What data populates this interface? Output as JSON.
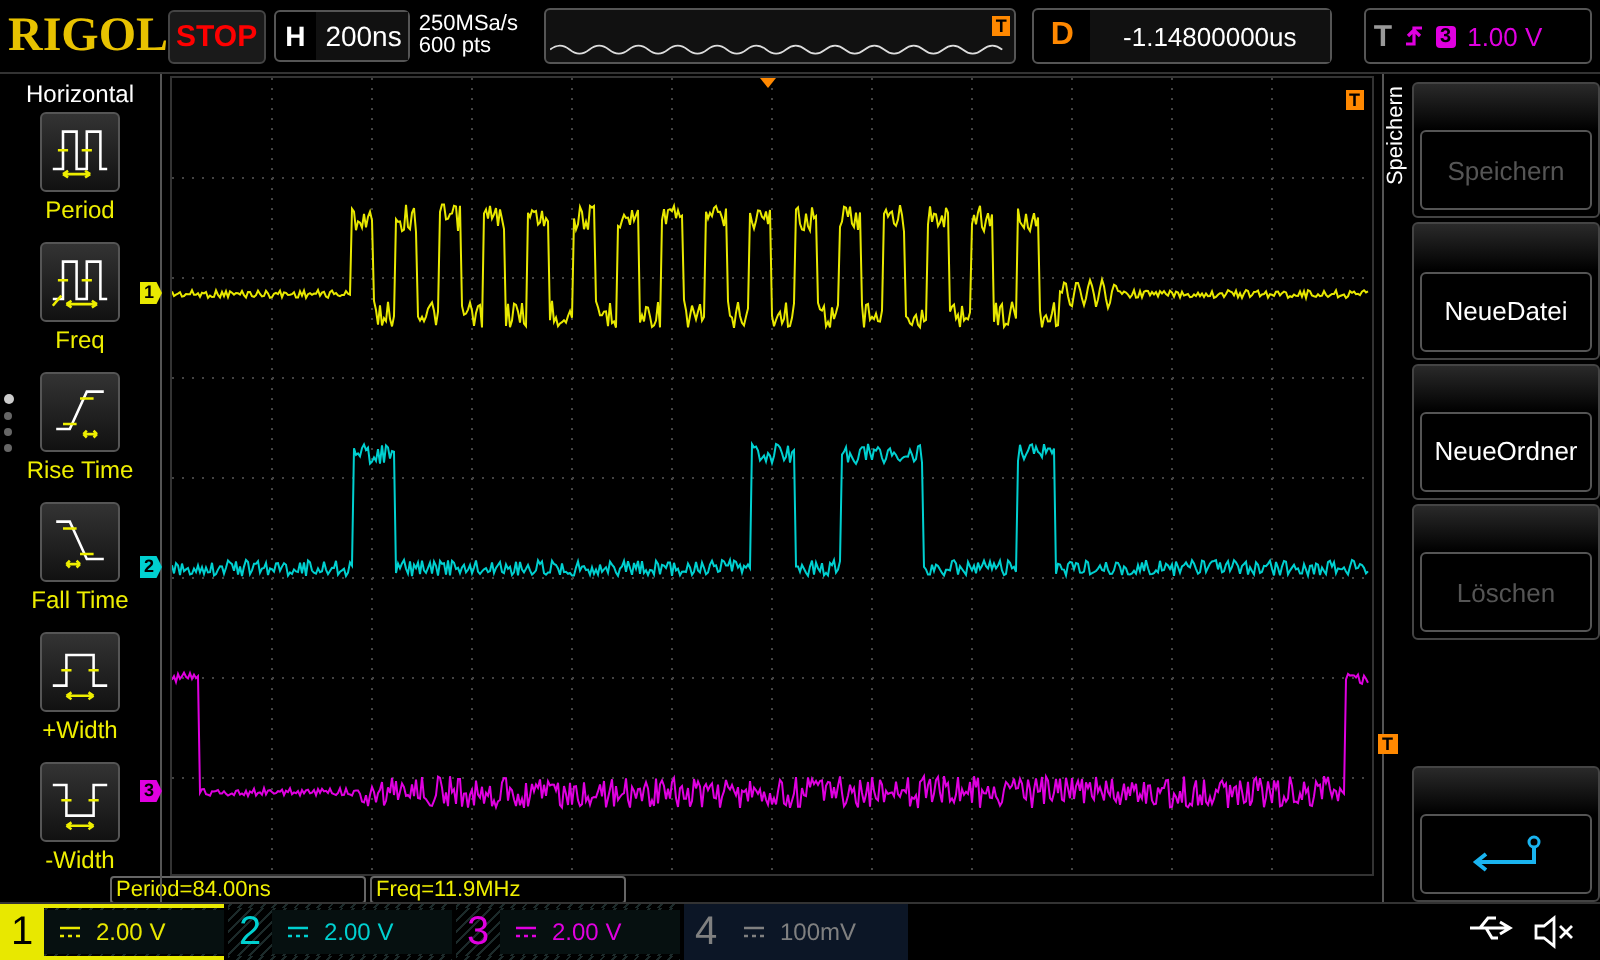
{
  "brand": "RIGOL",
  "run_state": {
    "label": "STOP"
  },
  "horizontal": {
    "key": "H",
    "timebase": "200ns"
  },
  "acquisition": {
    "sample_rate": "250MSa/s",
    "memory_depth": "600 pts",
    "trigger_marker": "T"
  },
  "delay": {
    "key": "D",
    "value": "-1.14800000us"
  },
  "trigger": {
    "key": "T",
    "source": "3",
    "level": "1.00 V",
    "color": "#e000e0"
  },
  "measure_menu": {
    "title": "Horizontal",
    "items": [
      {
        "kind": "period",
        "label": "Period"
      },
      {
        "kind": "freq",
        "label": "Freq"
      },
      {
        "kind": "rise",
        "label": "Rise Time"
      },
      {
        "kind": "fall",
        "label": "Fall Time"
      },
      {
        "kind": "pwidth",
        "label": "+Width"
      },
      {
        "kind": "nwidth",
        "label": "-Width"
      }
    ]
  },
  "plot": {
    "trigger_position_marker": "T",
    "trigger_level_marker": "T",
    "channel_markers": [
      {
        "label": "1",
        "color": "#e8e800"
      },
      {
        "label": "2",
        "color": "#00d0d0"
      },
      {
        "label": "3",
        "color": "#e000e0"
      }
    ]
  },
  "softkey_menu": {
    "title": "Speichern",
    "items": [
      {
        "kind": "text",
        "label": "Speichern",
        "disabled": true
      },
      {
        "kind": "text",
        "label": "NeueDatei",
        "disabled": false
      },
      {
        "kind": "text",
        "label": "NeueOrdner",
        "disabled": false
      },
      {
        "kind": "text",
        "label": "Löschen",
        "disabled": true
      },
      {
        "kind": "spacer"
      },
      {
        "kind": "back"
      }
    ]
  },
  "measurements": [
    "Period=84.00ns",
    "Freq=11.9MHz"
  ],
  "channels": [
    {
      "number": "1",
      "scale": "2.00 V",
      "color": "#e8e800",
      "selected": true,
      "on": true
    },
    {
      "number": "2",
      "scale": "2.00 V",
      "color": "#00d0d0",
      "selected": false,
      "on": true
    },
    {
      "number": "3",
      "scale": "2.00 V",
      "color": "#e000e0",
      "selected": false,
      "on": true
    },
    {
      "number": "4",
      "scale": "100mV",
      "color": "#808080",
      "selected": false,
      "on": false
    }
  ]
}
